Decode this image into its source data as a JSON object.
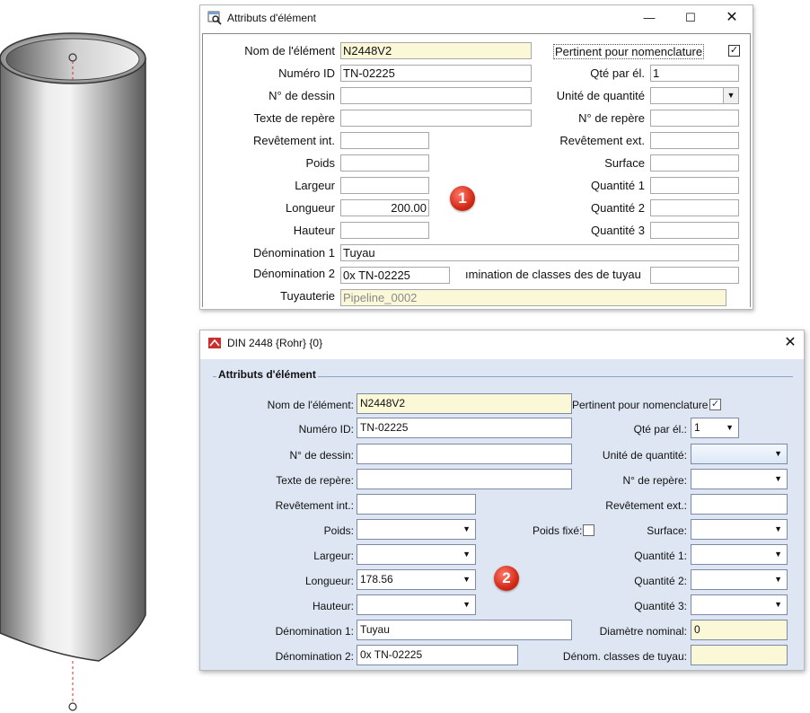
{
  "dialog1": {
    "title": "Attributs d'élément",
    "badge": "1",
    "labels": {
      "nom": "Nom de l'élément",
      "numero": "Numéro ID",
      "dessin": "N° de dessin",
      "texte": "Texte de repère",
      "revint": "Revêtement int.",
      "poids": "Poids",
      "largeur": "Largeur",
      "longueur": "Longueur",
      "hauteur": "Hauteur",
      "denom1": "Dénomination 1",
      "denom2": "Dénomination 2",
      "tuyauterie": "Tuyauterie",
      "pertinent": "Pertinent pour nomenclature",
      "qte": "Qté par él.",
      "unite": "Unité de quantité",
      "repere": "N° de repère",
      "revext": "Revêtement ext.",
      "surface": "Surface",
      "quantite1": "Quantité 1",
      "quantite2": "Quantité 2",
      "quantite3": "Quantité 3",
      "classes": "ımination de classes des de tuyau"
    },
    "values": {
      "nom": "N2448V2",
      "numero": "TN-02225",
      "dessin": "",
      "texte": "",
      "revint": "",
      "poids": "",
      "largeur": "",
      "longueur": "200.00",
      "hauteur": "",
      "denom1": "Tuyau",
      "denom2": "0x TN-02225",
      "tuyauterie": "Pipeline_0002",
      "pertinent_checked": true,
      "qte": "1",
      "unite": "",
      "repere": "",
      "revext": "",
      "surface": "",
      "quantite1": "",
      "quantite2": "",
      "quantite3": "",
      "classes": ""
    }
  },
  "dialog2": {
    "title": "DIN 2448 {Rohr} {0}",
    "group_title": "Attributs d'élément",
    "badge": "2",
    "labels": {
      "nom": "Nom de l'élément:",
      "numero": "Numéro ID:",
      "dessin": "N° de dessin:",
      "texte": "Texte de repère:",
      "revint": "Revêtement int.:",
      "poids": "Poids:",
      "poidsfixe": "Poids fixé:",
      "largeur": "Largeur:",
      "longueur": "Longueur:",
      "hauteur": "Hauteur:",
      "denom1": "Dénomination 1:",
      "denom2": "Dénomination 2:",
      "pertinent": "Pertinent pour nomenclature",
      "qte": "Qté par él.:",
      "unite": "Unité de quantité:",
      "repere": "N° de repère:",
      "revext": "Revêtement ext.:",
      "surface": "Surface:",
      "quantite1": "Quantité 1:",
      "quantite2": "Quantité 2:",
      "quantite3": "Quantité 3:",
      "diametre": "Diamètre nominal:",
      "classes": "Dénom. classes de tuyau:"
    },
    "values": {
      "nom": "N2448V2",
      "numero": "TN-02225",
      "dessin": "",
      "texte": "",
      "revint": "",
      "poids": "",
      "poidsfixe_checked": false,
      "largeur": "",
      "longueur": "178.56",
      "hauteur": "",
      "denom1": "Tuyau",
      "denom2": "0x TN-02225",
      "pertinent_checked": true,
      "qte": "1",
      "unite": "",
      "repere": "",
      "revext": "",
      "surface": "",
      "quantite1": "",
      "quantite2": "",
      "quantite3": "",
      "diametre": "0",
      "classes": ""
    }
  },
  "colors": {
    "field_yellow": "#fbf8d8",
    "dialog2_bg": "#dde6f2",
    "badge_red": "#d42a18",
    "axis_red": "#d03030"
  },
  "icons": {
    "dialog1_title_icon": "search-window-icon",
    "dialog2_title_icon": "pipe-part-icon"
  }
}
